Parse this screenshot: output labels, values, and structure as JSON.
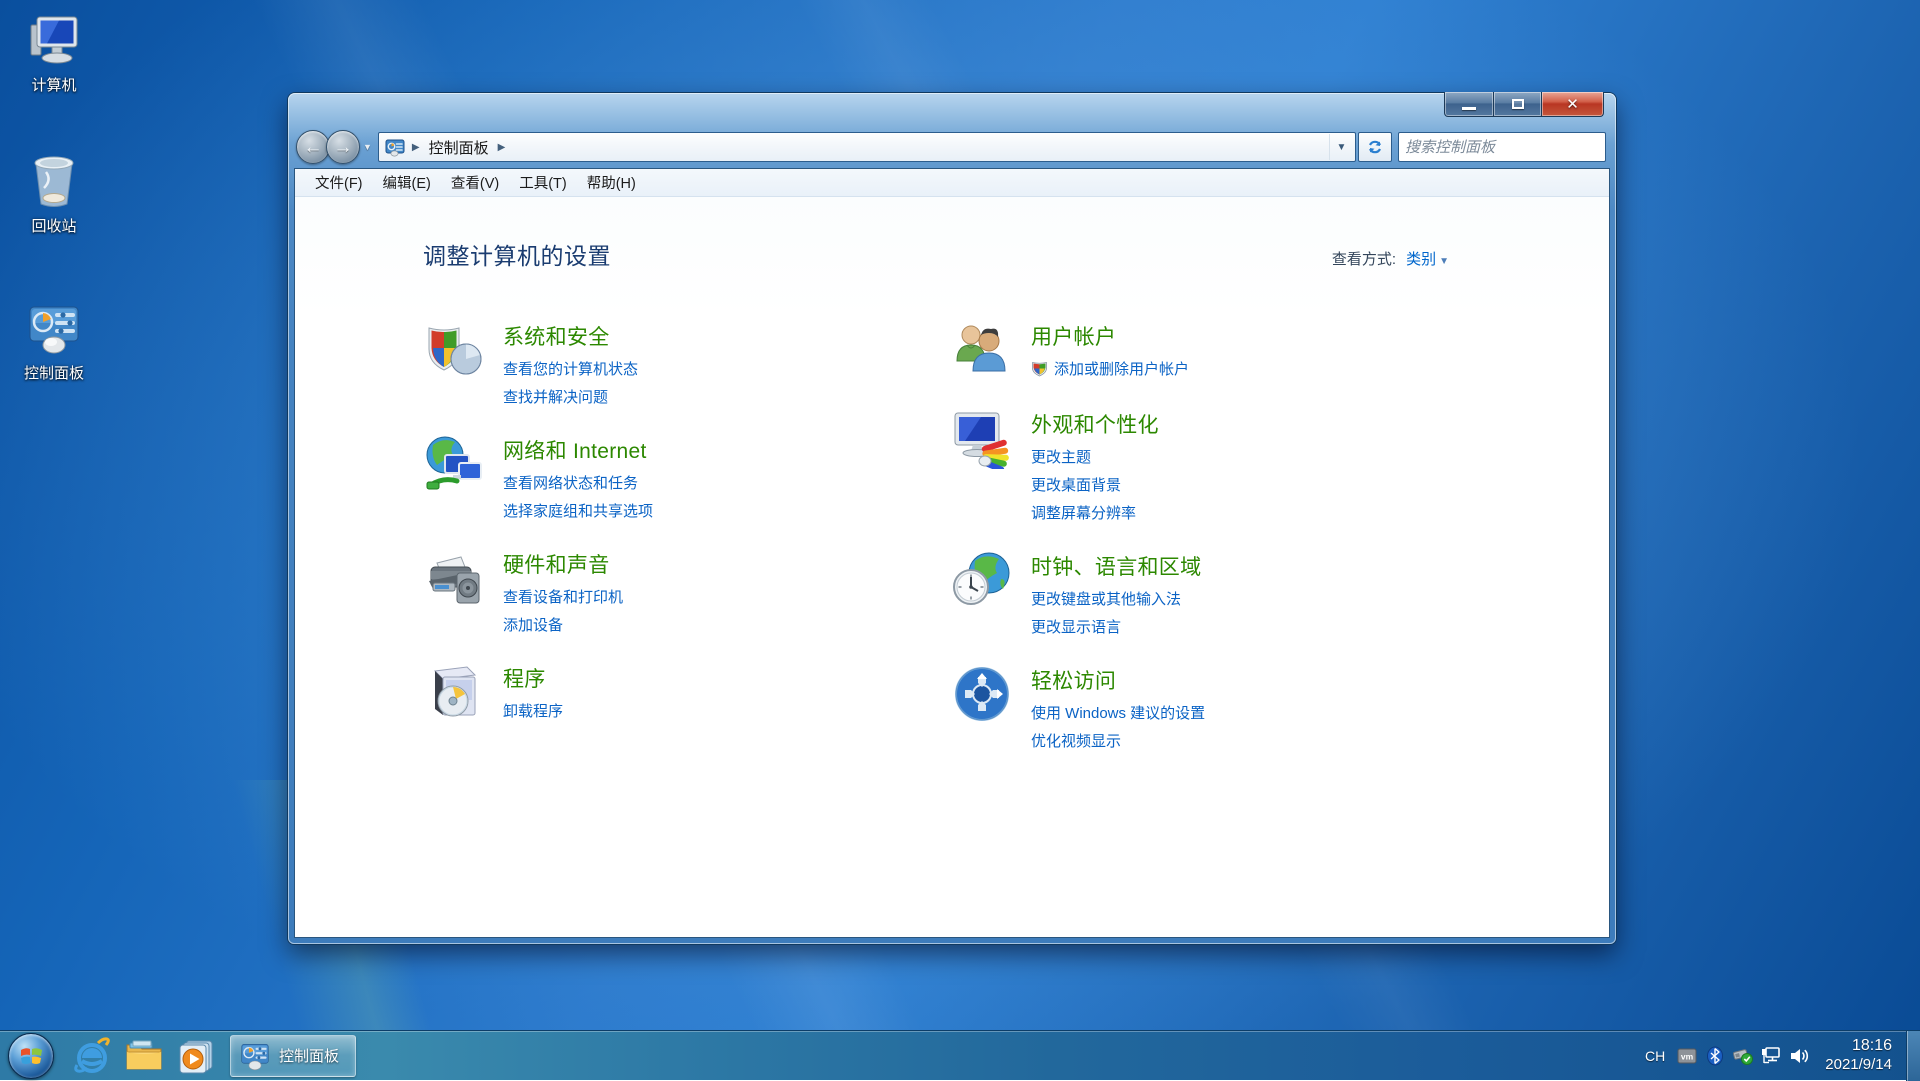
{
  "desktop": {
    "icons": [
      {
        "label": "计算机"
      },
      {
        "label": "回收站"
      },
      {
        "label": "控制面板"
      }
    ]
  },
  "window": {
    "breadcrumb": {
      "location": "控制面板"
    },
    "search": {
      "placeholder": "搜索控制面板"
    },
    "menu": [
      "文件(F)",
      "编辑(E)",
      "查看(V)",
      "工具(T)",
      "帮助(H)"
    ],
    "heading": "调整计算机的设置",
    "view_by": {
      "label": "查看方式:",
      "value": "类别"
    },
    "categories_left": [
      {
        "title": "系统和安全",
        "links": [
          "查看您的计算机状态",
          "查找并解决问题"
        ]
      },
      {
        "title": "网络和 Internet",
        "links": [
          "查看网络状态和任务",
          "选择家庭组和共享选项"
        ]
      },
      {
        "title": "硬件和声音",
        "links": [
          "查看设备和打印机",
          "添加设备"
        ]
      },
      {
        "title": "程序",
        "links": [
          "卸载程序"
        ]
      }
    ],
    "categories_right": [
      {
        "title": "用户帐户",
        "links": [
          "添加或删除用户帐户"
        ]
      },
      {
        "title": "外观和个性化",
        "links": [
          "更改主题",
          "更改桌面背景",
          "调整屏幕分辨率"
        ]
      },
      {
        "title": "时钟、语言和区域",
        "links": [
          "更改键盘或其他输入法",
          "更改显示语言"
        ]
      },
      {
        "title": "轻松访问",
        "links": [
          "使用 Windows 建议的设置",
          "优化视频显示"
        ]
      }
    ]
  },
  "taskbar": {
    "active_task_label": "控制面板"
  },
  "tray": {
    "input_indicator": "CH",
    "time": "18:16",
    "date": "2021/9/14"
  },
  "colors": {
    "category_title_green": "#2c8800",
    "task_link_blue": "#0b63c5",
    "heading_navy": "#1a3c70",
    "close_button_red": "#b83623"
  }
}
